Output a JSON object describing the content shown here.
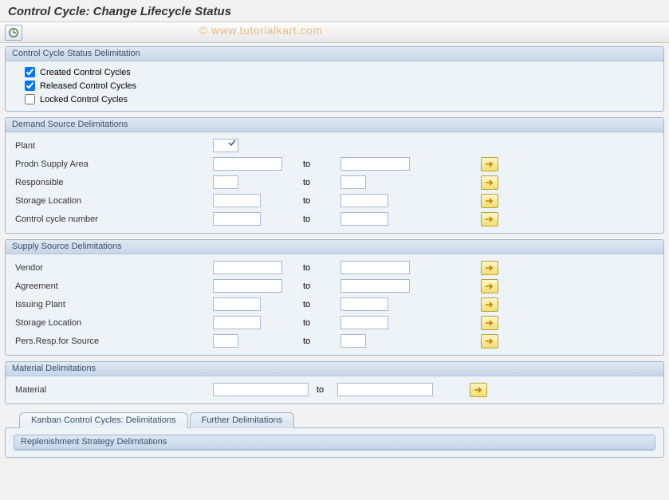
{
  "title": "Control Cycle: Change Lifecycle Status",
  "watermark": "© www.tutorialkart.com",
  "group_status": {
    "title": "Control Cycle Status Delimitation",
    "items": [
      {
        "label": "Created Control Cycles",
        "checked": true
      },
      {
        "label": "Released Control Cycles",
        "checked": true
      },
      {
        "label": "Locked Control Cycles",
        "checked": false
      }
    ]
  },
  "group_demand": {
    "title": "Demand Source Delimitations",
    "plant_label": "Plant",
    "rows": [
      {
        "label": "Prodn Supply Area",
        "w": "w87"
      },
      {
        "label": "Responsible",
        "w": "w32"
      },
      {
        "label": "Storage Location",
        "w": "w60"
      },
      {
        "label": "Control cycle number",
        "w": "w60"
      }
    ],
    "to": "to"
  },
  "group_supply": {
    "title": "Supply Source Delimitations",
    "rows": [
      {
        "label": "Vendor",
        "w": "w87"
      },
      {
        "label": "Agreement",
        "w": "w87"
      },
      {
        "label": "Issuing Plant",
        "w": "w60"
      },
      {
        "label": "Storage Location",
        "w": "w60"
      },
      {
        "label": "Pers.Resp.for Source",
        "w": "w32"
      }
    ],
    "to": "to"
  },
  "group_material": {
    "title": "Material Delimitations",
    "label": "Material",
    "to": "to"
  },
  "tabs": {
    "t1": "Kanban Control Cycles: Delimitations",
    "t2": "Further Delimitations"
  },
  "group_repl": {
    "title": "Replenishment Strategy Delimitations"
  }
}
